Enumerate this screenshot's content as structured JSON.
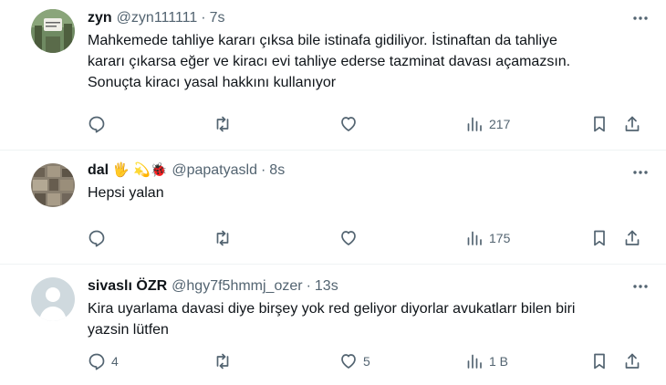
{
  "tweets": [
    {
      "name": "zyn",
      "handle": "@zyn111111",
      "separator": "·",
      "time": "7s",
      "lines": [
        "Mahkemede tahliye kararı çıksa bile istinafa gidiliyor. İstinaftan da tahliye",
        "kararı çıkarsa eğer ve kiracı evi tahliye ederse tazminat davası açamazsın.",
        "Sonuçta kiracı yasal hakkını kullanıyor"
      ],
      "replies": "",
      "reposts": "",
      "likes": "",
      "views": "217"
    },
    {
      "name": "dal",
      "emoji": "🖐 💫🐞",
      "handle": "@papatyasld",
      "separator": "·",
      "time": "8s",
      "lines": [
        "Hepsi yalan"
      ],
      "replies": "",
      "reposts": "",
      "likes": "",
      "views": "175"
    },
    {
      "name": "sivaslı ÖZR",
      "handle": "@hgy7f5hmmj_ozer",
      "separator": "·",
      "time": "13s",
      "lines": [
        "Kira uyarlama davasi diye birşey yok red geliyor diyorlar avukatlarr bilen biri",
        "yazsin lütfen"
      ],
      "replies": "4",
      "reposts": "",
      "likes": "5",
      "views": "1 B"
    }
  ],
  "icons": {
    "reply": "reply-icon",
    "repost": "repost-icon",
    "like": "heart-icon",
    "views": "views-icon",
    "bookmark": "bookmark-icon",
    "share": "share-icon",
    "more": "more-icon"
  },
  "colors": {
    "text": "#0f1419",
    "muted": "#536471",
    "divider": "#eff3f4"
  }
}
